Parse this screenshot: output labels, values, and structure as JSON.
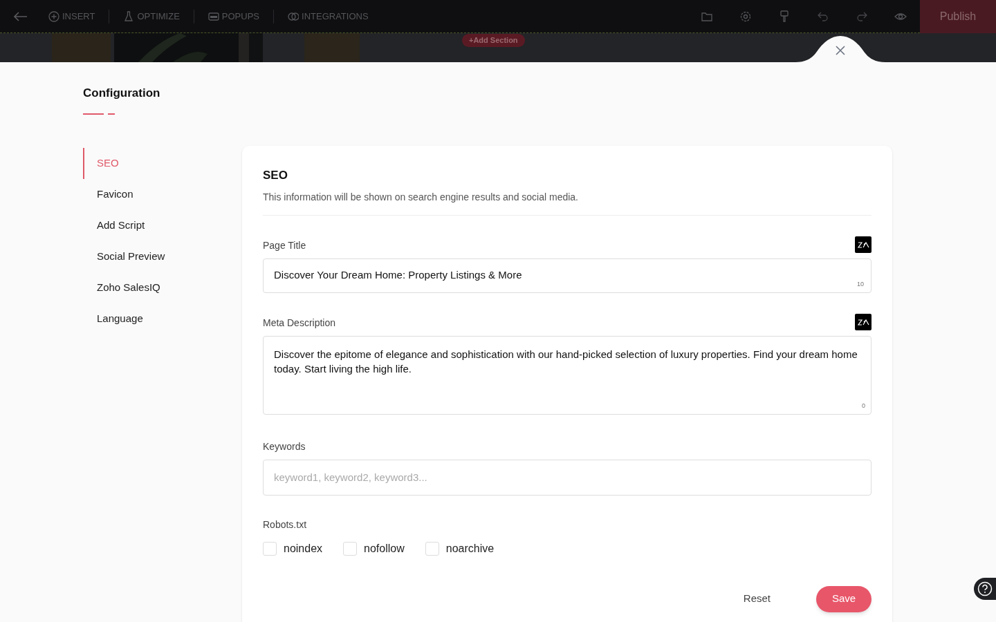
{
  "toolbar": {
    "menu": [
      {
        "label": "INSERT",
        "kind": "insert"
      },
      {
        "label": "OPTIMIZE",
        "kind": "optimize"
      },
      {
        "label": "POPUPS",
        "kind": "popups"
      },
      {
        "label": "INTEGRATIONS",
        "kind": "integrations"
      }
    ],
    "tools": [
      {
        "kind": "folder"
      },
      {
        "kind": "settings"
      },
      {
        "kind": "brush"
      },
      {
        "kind": "undo"
      },
      {
        "kind": "redo"
      },
      {
        "kind": "preview"
      }
    ],
    "publish": "Publish"
  },
  "canvas": {
    "kind": "picture",
    "add_section": "+Add Section"
  },
  "config": {
    "title": "Configuration",
    "nav": [
      {
        "label": "SEO",
        "selected": true
      },
      {
        "label": "Favicon",
        "selected": false
      },
      {
        "label": "Add Script",
        "selected": false
      },
      {
        "label": "Social Preview",
        "selected": false
      },
      {
        "label": "Zoho SalesIQ",
        "selected": false
      },
      {
        "label": "Language",
        "selected": false
      }
    ]
  },
  "seo": {
    "title": "SEO",
    "subtitle": "This information will be shown on search engine results and social media.",
    "page_title": {
      "label": "Page Title",
      "value": "Discover Your Dream Home: Property Listings & More",
      "count": "10"
    },
    "meta_description": {
      "label": "Meta Description",
      "value": "Discover the epitome of elegance and sophistication with our hand-picked selection of luxury properties. Find your dream home today. Start living the high life.",
      "count": "0"
    },
    "keywords": {
      "label": "Keywords",
      "placeholder": "keyword1, keyword2, keyword3..."
    },
    "robots": {
      "label": "Robots.txt",
      "options": [
        {
          "label": "noindex",
          "checked": false
        },
        {
          "label": "nofollow",
          "checked": false
        },
        {
          "label": "noarchive",
          "checked": false
        }
      ]
    },
    "buttons": {
      "reset": "Reset",
      "save": "Save"
    }
  }
}
